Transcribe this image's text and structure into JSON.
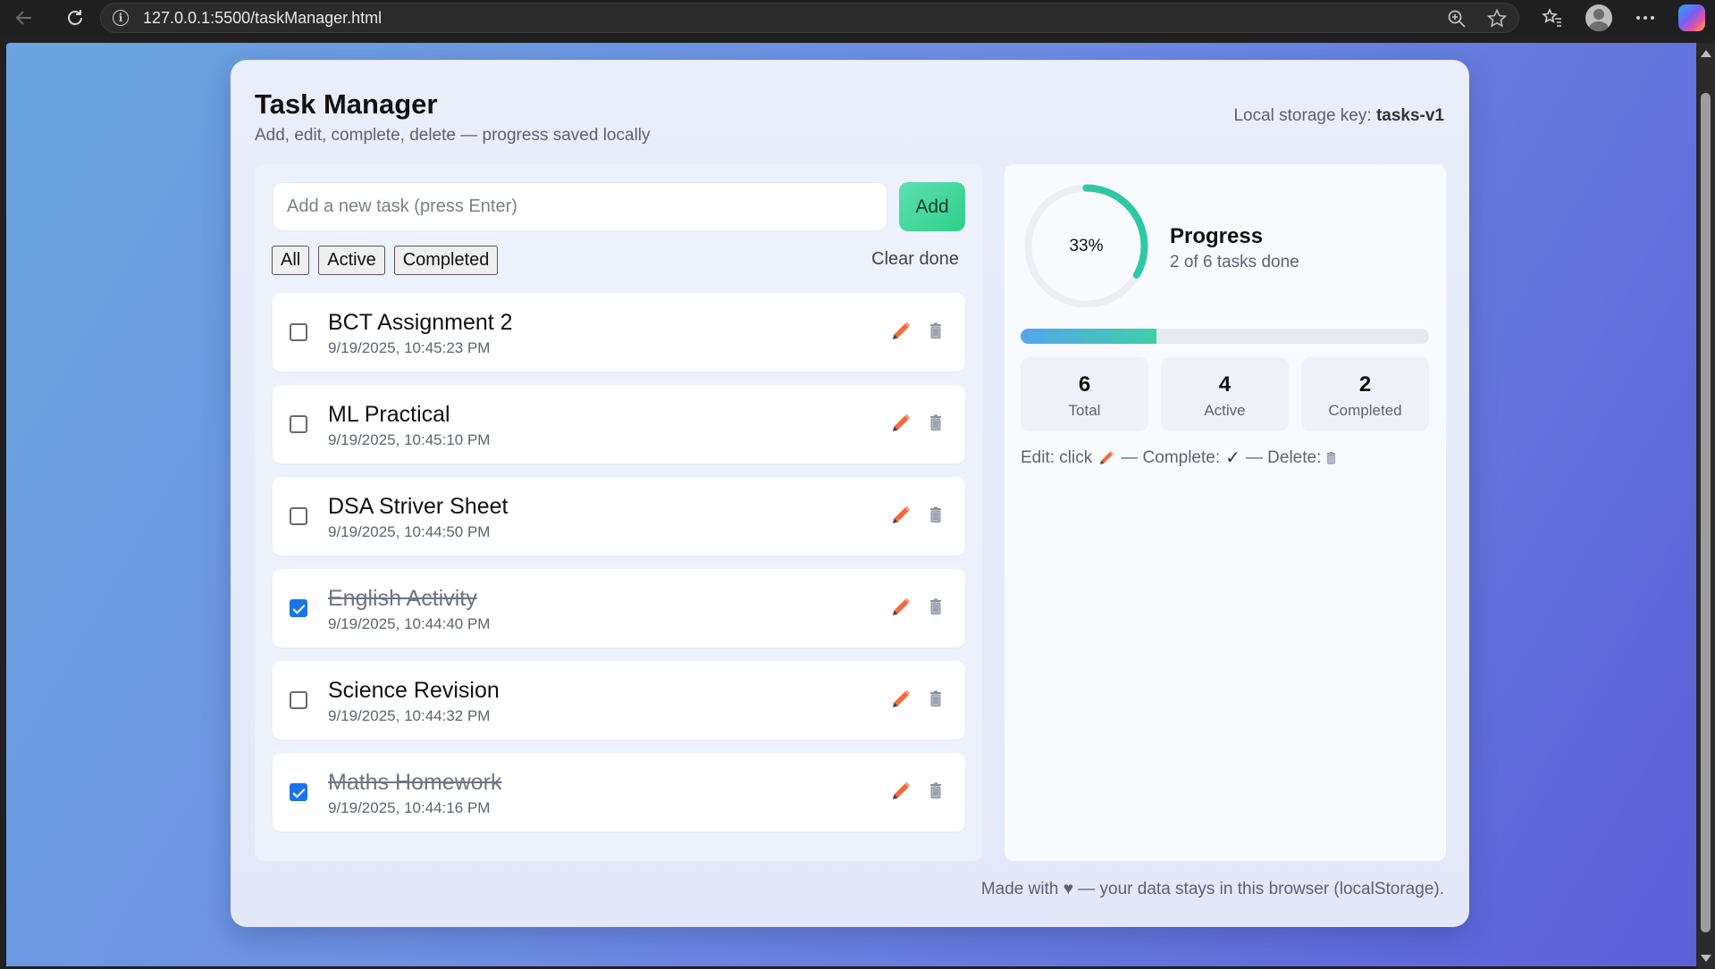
{
  "browser": {
    "url": "127.0.0.1:5500/taskManager.html"
  },
  "app": {
    "title": "Task Manager",
    "subtitle": "Add, edit, complete, delete — progress saved locally",
    "storage_label": "Local storage key:",
    "storage_key": "tasks-v1"
  },
  "input": {
    "placeholder": "Add a new task (press Enter)",
    "value": "",
    "add_label": "Add"
  },
  "filters": {
    "all": "All",
    "active": "Active",
    "completed": "Completed",
    "clear": "Clear done"
  },
  "tasks": [
    {
      "title": "BCT Assignment 2",
      "time": "9/19/2025, 10:45:23 PM",
      "done": false
    },
    {
      "title": "ML Practical",
      "time": "9/19/2025, 10:45:10 PM",
      "done": false
    },
    {
      "title": "DSA Striver Sheet",
      "time": "9/19/2025, 10:44:50 PM",
      "done": false
    },
    {
      "title": "English Activity",
      "time": "9/19/2025, 10:44:40 PM",
      "done": true
    },
    {
      "title": "Science Revision",
      "time": "9/19/2025, 10:44:32 PM",
      "done": false
    },
    {
      "title": "Maths Homework",
      "time": "9/19/2025, 10:44:16 PM",
      "done": true
    }
  ],
  "progress": {
    "percent_label": "33%",
    "fraction": 0.333,
    "title": "Progress",
    "subtitle": "2 of 6 tasks done",
    "ring_color": "#2ec9a3",
    "bar_color_start": "#54a6ee",
    "bar_color_end": "#3fd0a8"
  },
  "stats": {
    "total_value": "6",
    "total_label": "Total",
    "active_value": "4",
    "active_label": "Active",
    "completed_value": "2",
    "completed_label": "Completed"
  },
  "hint": {
    "edit": "Edit: click",
    "complete": "— Complete:",
    "check": "✓",
    "delete": "— Delete:"
  },
  "footer": "Made with ♥ — your data stays in this browser (localStorage).",
  "icons": {
    "edit": "pencil-icon",
    "delete": "trash-icon"
  },
  "colors": {
    "pencil": "#f06a3c",
    "checkbox_checked": "#1a73e8",
    "add_button": "#3fd497"
  }
}
